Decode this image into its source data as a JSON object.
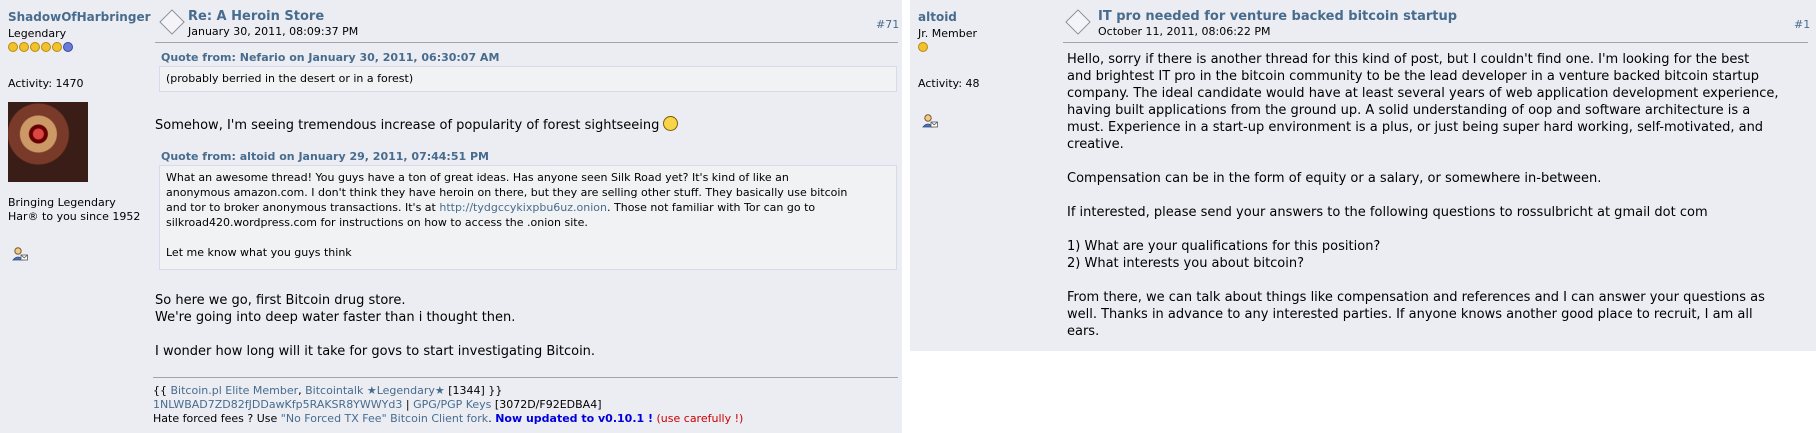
{
  "post_left": {
    "username": "ShadowOfHarbringer",
    "rank": "Legendary",
    "activity": "Activity: 1470",
    "bio_line1": "Bringing Legendary",
    "bio_line2": "Har® to you since 1952",
    "subject": "Re: A Heroin Store",
    "date": "January 30, 2011, 08:09:37 PM",
    "post_number": "#71",
    "quote1_header": "Quote from: Nefario on January 30, 2011, 06:30:07 AM",
    "quote1_text": "(probably berried in the desert or in a forest)",
    "para1": "Somehow, I'm seeing tremendous increase of popularity of forest sightseeing",
    "quote2_header": "Quote from: altoid on January 29, 2011, 07:44:51 PM",
    "quote2_line1": "What an awesome thread!  You guys have a ton of great ideas.  Has anyone seen Silk Road yet?  It's kind of like an",
    "quote2_line2": "anonymous amazon.com.  I don't think they have heroin on there, but they are selling other stuff.  They basically use bitcoin",
    "quote2_line3a": "and tor to broker anonymous transactions.  It's at ",
    "quote2_link": "http://tydgccykixpbu6uz.onion",
    "quote2_line3b": ".  Those not familiar with Tor can go to",
    "quote2_line4": "silkroad420.wordpress.com for instructions on how to access the .onion site.",
    "quote2_line5": "Let me know what you guys think",
    "body_line1": "So here we go, first Bitcoin drug store.",
    "body_line2": "We're going into deep water faster than i thought then.",
    "body_line3": "I wonder how long will it take for govs to start investigating Bitcoin.",
    "sig_open": "{{ ",
    "sig_link1": "Bitcoin.pl Elite Member",
    "sig_sep1": ", ",
    "sig_link2": "Bitcointalk ★Legendary★",
    "sig_count": " [1344] }}",
    "sig_addr": "1NLWBAD7ZD82fJDDawKfp5RAKSR8YWWYd3",
    "sig_sep2": " | ",
    "sig_gpg": "GPG/PGP Keys",
    "sig_key": " [3072D/F92EDBA4]",
    "sig_fees_a": "Hate forced fees ? Use ",
    "sig_fees_link": "\"No Forced TX Fee\" Bitcoin Client fork",
    "sig_fees_b": ". ",
    "sig_updated": "Now updated to v0.10.1 !",
    "sig_careful": " (use carefully !)"
  },
  "post_right": {
    "username": "altoid",
    "rank": "Jr. Member",
    "activity": "Activity: 48",
    "subject": "IT pro needed for venture backed bitcoin startup",
    "date": "October 11, 2011, 08:06:22 PM",
    "post_number": "#1",
    "para1_l1": "Hello, sorry if there is another thread for this kind of post, but I couldn't find one.  I'm looking for the best",
    "para1_l2": "and brightest IT pro in the bitcoin community to be the lead developer in a venture backed bitcoin startup",
    "para1_l3": "company.  The ideal candidate would have at least several years of web application development experience,",
    "para1_l4": "having built applications from the ground up.  A solid understanding of oop and software architecture is a",
    "para1_l5": "must.  Experience in a start-up environment is a plus, or just being super hard working, self-motivated, and",
    "para1_l6": "creative.",
    "para2": "Compensation can be in the form of equity or a salary, or somewhere in-between.",
    "para3": "If interested, please send your answers to the following questions to rossulbricht at gmail dot com",
    "q1": "1) What are your qualifications for this position?",
    "q2": "2) What interests you about bitcoin?",
    "para4_l1": "From there, we can talk about things like compensation and references and I can answer your questions as",
    "para4_l2": "well.  Thanks in advance to any interested parties.  If anyone knows another good place to recruit, I am all",
    "para4_l3": "ears."
  },
  "icons": {
    "message": "message-icon",
    "pm": "personal-message-icon",
    "star": "rank-star-icon",
    "smiley": "smiley-icon"
  },
  "colors": {
    "link": "#476C8E",
    "panel_bg": "#ECEDF3",
    "quote_bg": "#F1F2F4",
    "updated": "#0000dd",
    "careful": "#cc0000"
  }
}
